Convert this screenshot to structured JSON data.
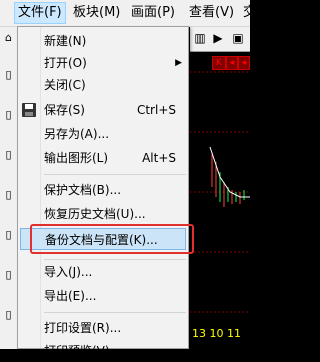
{
  "menubar": {
    "items": [
      {
        "label": "文件(F)",
        "active": true
      },
      {
        "label": "板块(M)",
        "active": false
      },
      {
        "label": "画面(P)",
        "active": false
      },
      {
        "label": "查看(V)",
        "active": false
      },
      {
        "label": "交",
        "active": false
      }
    ]
  },
  "file_menu": {
    "items": [
      {
        "label": "新建(N)",
        "shortcut": "",
        "submenu": false,
        "icon": ""
      },
      {
        "label": "打开(O)",
        "shortcut": "",
        "submenu": true,
        "icon": ""
      },
      {
        "label": "关闭(C)",
        "shortcut": "",
        "submenu": false,
        "icon": ""
      },
      {
        "label": "保存(S)",
        "shortcut": "Ctrl+S",
        "submenu": false,
        "icon": "save-icon"
      },
      {
        "label": "另存为(A)...",
        "shortcut": "",
        "submenu": false,
        "icon": ""
      },
      {
        "label": "输出图形(L)",
        "shortcut": "Alt+S",
        "submenu": false,
        "icon": ""
      },
      {
        "label": "保护文档(B)...",
        "shortcut": "",
        "submenu": false,
        "icon": ""
      },
      {
        "label": "恢复历史文档(U)...",
        "shortcut": "",
        "submenu": false,
        "icon": ""
      },
      {
        "label": "备份文档与配置(K)...",
        "shortcut": "",
        "submenu": false,
        "icon": "",
        "highlighted": true
      },
      {
        "label": "导入(J)...",
        "shortcut": "",
        "submenu": false,
        "icon": ""
      },
      {
        "label": "导出(E)...",
        "shortcut": "",
        "submenu": false,
        "icon": ""
      },
      {
        "label": "打印设置(R)...",
        "shortcut": "",
        "submenu": false,
        "icon": ""
      },
      {
        "label": "打印预览(V)",
        "shortcut": "",
        "submenu": false,
        "icon": ""
      }
    ]
  },
  "chart": {
    "k_label": "K",
    "ticker": "13 10 11"
  },
  "colors": {
    "menu_bg": "#f2f2f2",
    "highlight_bg": "#cce4f7",
    "highlight_border": "#7fb6e6",
    "annotation_red": "#e03030",
    "chart_bg": "#000000"
  }
}
